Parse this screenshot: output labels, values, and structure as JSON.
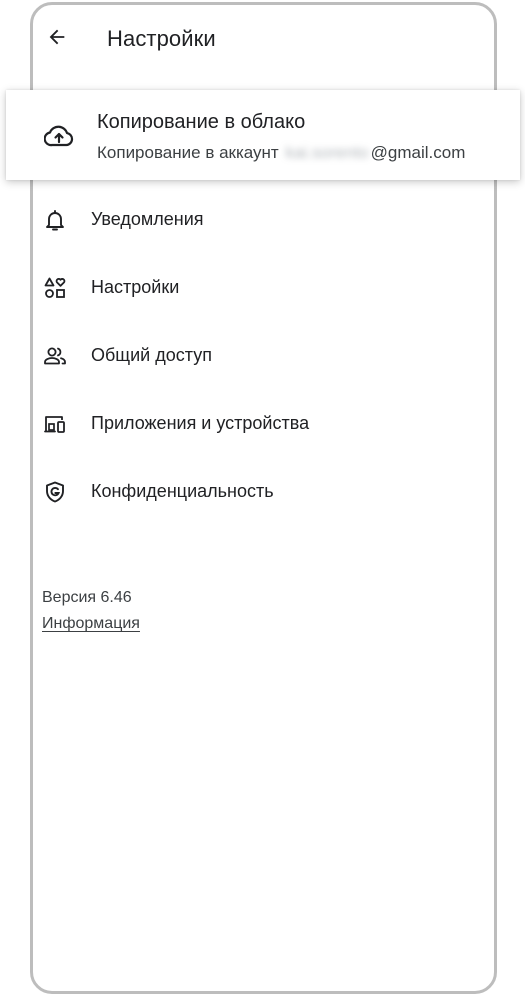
{
  "header": {
    "title": "Настройки",
    "back_icon": "arrow-back-icon"
  },
  "backup": {
    "title": "Копирование в облако",
    "subtitle_prefix": "Копирование в аккаунт",
    "email_blurred": "kai.sorento",
    "email_domain": "@gmail.com",
    "icon": "cloud-upload-icon"
  },
  "menu": {
    "items": [
      {
        "label": "Уведомления",
        "icon": "bell-icon"
      },
      {
        "label": "Настройки",
        "icon": "shapes-icon"
      },
      {
        "label": "Общий доступ",
        "icon": "people-icon"
      },
      {
        "label": "Приложения и устройства",
        "icon": "devices-icon"
      },
      {
        "label": "Конфиденциальность",
        "icon": "shield-icon"
      }
    ]
  },
  "footer": {
    "version": "Версия 6.46",
    "info_link": "Информация"
  },
  "colors": {
    "text": "#202124",
    "secondary_text": "#3c4043",
    "frame_border": "#bdbdbd"
  }
}
